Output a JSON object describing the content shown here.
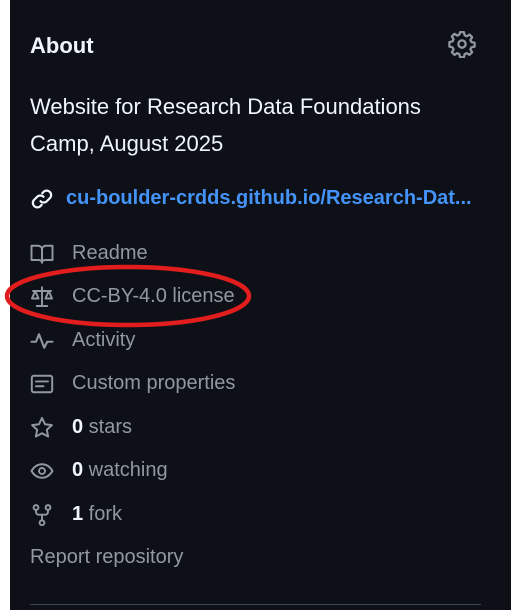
{
  "about": {
    "title": "About",
    "settings_icon": "gear-icon",
    "description": "Website for Research Data Foundations Camp, August 2025",
    "homepage": {
      "icon": "link-icon",
      "text": "cu-boulder-crdds.github.io/Research-Dat..."
    },
    "items": [
      {
        "icon": "book-icon",
        "label": "Readme"
      },
      {
        "icon": "law-icon",
        "label": "CC-BY-4.0 license"
      },
      {
        "icon": "pulse-icon",
        "label": "Activity"
      },
      {
        "icon": "note-icon",
        "label": "Custom properties"
      },
      {
        "icon": "star-icon",
        "count": "0",
        "label": " stars"
      },
      {
        "icon": "eye-icon",
        "count": "0",
        "label": " watching"
      },
      {
        "icon": "repo-forked-icon",
        "count": "1",
        "label": " fork"
      }
    ],
    "report": "Report repository"
  },
  "colors": {
    "background": "#0d1117",
    "text": "#f0f6fc",
    "muted": "#9198a1",
    "link": "#4493f8",
    "annotation": "#e11d1d"
  }
}
